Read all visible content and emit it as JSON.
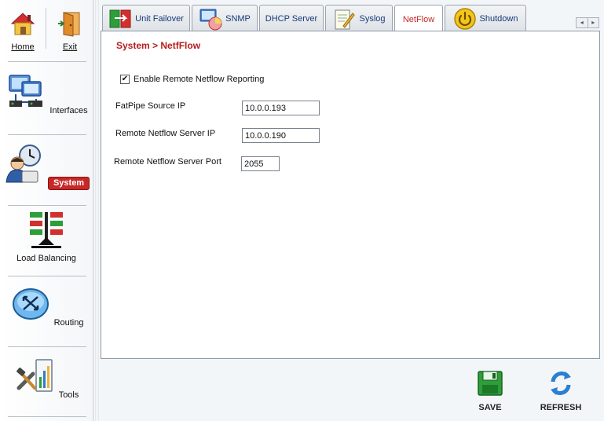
{
  "sidebar": {
    "home_label": "Home",
    "exit_label": "Exit",
    "items": [
      {
        "label": "Interfaces",
        "icon": "interfaces-icon"
      },
      {
        "label": "System",
        "icon": "system-icon",
        "active": true
      },
      {
        "label": "Load Balancing",
        "icon": "load-balancing-icon"
      },
      {
        "label": "Routing",
        "icon": "routing-icon"
      },
      {
        "label": "Tools",
        "icon": "tools-icon"
      }
    ]
  },
  "tabs": [
    {
      "label": "Unit Failover",
      "icon": "unit-failover-icon"
    },
    {
      "label": "SNMP",
      "icon": "snmp-icon"
    },
    {
      "label": "DHCP Server"
    },
    {
      "label": "Syslog",
      "icon": "syslog-icon"
    },
    {
      "label": "NetFlow",
      "active": true
    },
    {
      "label": "Shutdown",
      "icon": "power-icon"
    }
  ],
  "tab_scroll": {
    "left": "◂",
    "right": "▸"
  },
  "main": {
    "breadcrumb": "System > NetfFlow",
    "enable_checkbox": {
      "label": "Enable Remote Netflow Reporting",
      "checked": true,
      "mark": "✔"
    },
    "fields": [
      {
        "label": "FatPipe Source IP",
        "value": "10.0.0.193"
      },
      {
        "label": "Remote Netflow Server IP",
        "value": "10.0.0.190"
      },
      {
        "label": "Remote Netflow Server Port",
        "value": "2055"
      }
    ]
  },
  "actions": {
    "save_label": "SAVE",
    "refresh_label": "REFRESH"
  },
  "colors": {
    "accent_red": "#c62828",
    "tab_text_blue": "#163a7a",
    "save_green": "#2e9e3a",
    "refresh_blue": "#2a7fd0"
  }
}
